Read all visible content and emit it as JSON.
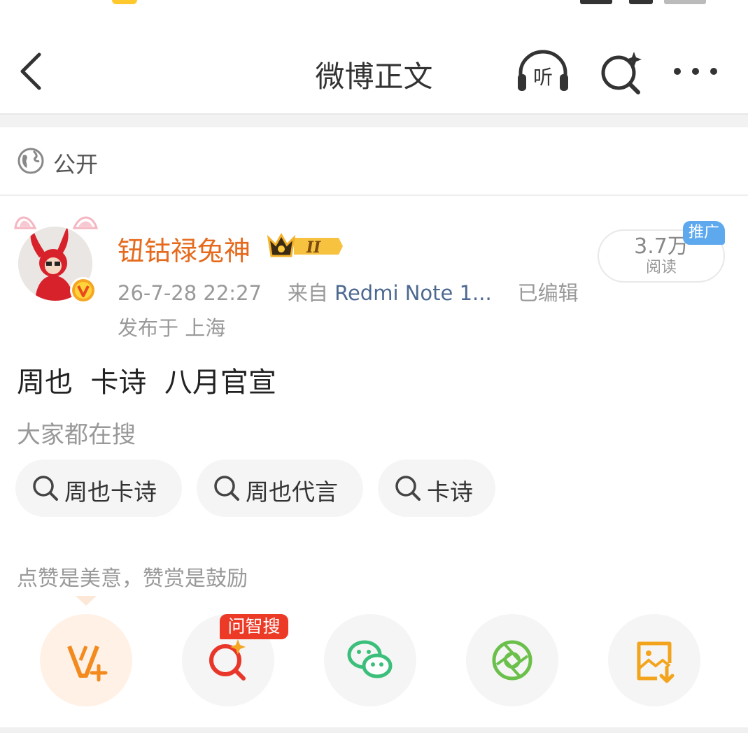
{
  "colors": {
    "accent_orange": "#e56a1d",
    "link_blue": "#4d6990",
    "promo_blue": "#5ea9ee",
    "ai_red": "#ec3a27",
    "wechat_green": "#3cbf7a",
    "moments_green": "#6bc04b",
    "save_orange": "#f3a41d"
  },
  "nav": {
    "title": "微博正文",
    "listen_icon": "headphones-listen-icon",
    "listen_glyph": "听",
    "search_icon": "ai-search-icon",
    "more_icon": "more-dots-icon",
    "back_icon": "chevron-left-icon"
  },
  "visibility": {
    "icon": "globe-icon",
    "label": "公开"
  },
  "author": {
    "name": "钮钴禄兔神",
    "vip_level": "II",
    "verified": true
  },
  "post_meta": {
    "time": "26-7-28 22:27",
    "source_prefix": "来自",
    "source": "Redmi Note 1...",
    "edited": "已编辑",
    "location": "发布于 上海"
  },
  "read_count": {
    "value": "3.7万",
    "label": "阅读",
    "promo_tag": "推广"
  },
  "post": {
    "text": "周也  卡诗  八月官宣"
  },
  "trending": {
    "heading": "大家都在搜",
    "chips": [
      {
        "label": "周也卡诗"
      },
      {
        "label": "周也代言"
      },
      {
        "label": "卡诗"
      }
    ]
  },
  "reward": {
    "caption": "点赞是美意，赞赏是鼓励"
  },
  "actions": {
    "ai_tag": "问智搜",
    "buttons": [
      {
        "name": "reward-v-plus-icon"
      },
      {
        "name": "ai-search-icon"
      },
      {
        "name": "wechat-icon"
      },
      {
        "name": "moments-icon"
      },
      {
        "name": "save-image-icon"
      }
    ]
  }
}
